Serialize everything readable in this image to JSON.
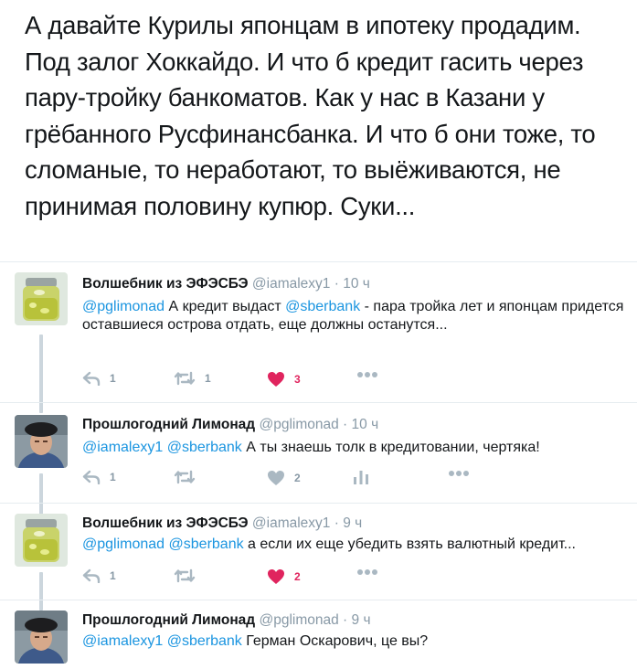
{
  "main_tweet": {
    "text": "А давайте Курилы японцам в ипотеку продадим. Под залог Хоккайдо. И что б кредит гасить через пару-тройку банкоматов. Как у нас в Казани у грёбанного Русфинансбанка. И что б они тоже, то сломаные, то неработают, то выёживаются, не принимая половину купюр. Суки..."
  },
  "replies": [
    {
      "name": "Волшебник из ЭФЭСБЭ",
      "handle": "@iamalexy1",
      "dot": "·",
      "time": "10 ч",
      "mention1": "@pglimonad",
      "text_a": " А кредит выдаст ",
      "mention2": "@sberbank",
      "text_b": " - пара тройка лет и японцам придется оставшиеся острова отдать, еще должны останутся...",
      "reply_count": "1",
      "retweet_count": "1",
      "like_count": "3",
      "liked": true,
      "avatar": "jar-avatar"
    },
    {
      "name": "Прошлогодний Лимонад",
      "handle": "@pglimonad",
      "dot": "·",
      "time": "10 ч",
      "mention1": "@iamalexy1",
      "text_a": " ",
      "mention2": "@sberbank",
      "text_b": " А ты знаешь толк в кредитовании, чертяка!",
      "reply_count": "1",
      "retweet_count": "",
      "like_count": "2",
      "liked": false,
      "avatar": "man-avatar"
    },
    {
      "name": "Волшебник из ЭФЭСБЭ",
      "handle": "@iamalexy1",
      "dot": "·",
      "time": "9 ч",
      "mention1": "@pglimonad",
      "text_a": " ",
      "mention2": "@sberbank",
      "text_b": " а если их еще убедить взять валютный кредит...",
      "reply_count": "1",
      "retweet_count": "",
      "like_count": "2",
      "liked": true,
      "avatar": "jar-avatar"
    },
    {
      "name": "Прошлогодний Лимонад",
      "handle": "@pglimonad",
      "dot": "·",
      "time": "9 ч",
      "mention1": "@iamalexy1",
      "text_a": " ",
      "mention2": "@sberbank",
      "text_b": " Герман Оскарович, це вы?",
      "avatar": "man-avatar"
    }
  ],
  "colors": {
    "accent": "#1b95e0",
    "like": "#e0245e",
    "muted": "#8899a6",
    "thread_line": "#ccd6dd"
  }
}
